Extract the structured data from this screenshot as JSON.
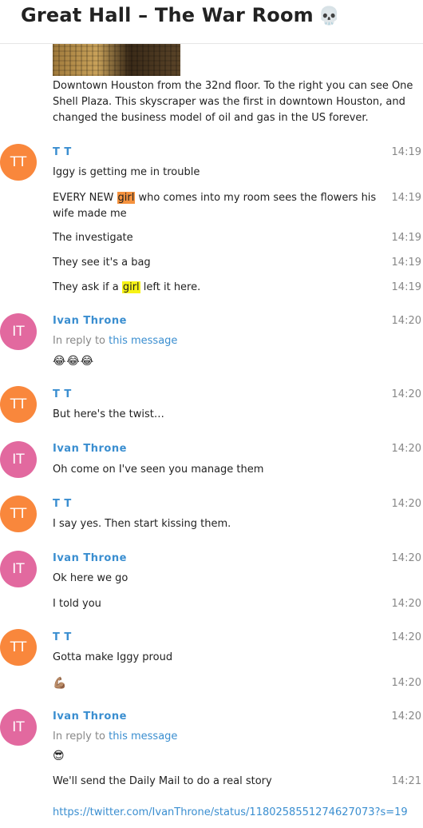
{
  "header": {
    "title": "Great Hall – The War Room",
    "title_emoji": "💀"
  },
  "photo_caption": "Downtown Houston from the 32nd floor. To the right you can see One Shell Plaza. This skyscraper was the first in downtown Houston, and changed the business model of oil and gas in the US forever.",
  "reply_prefix": "In reply to ",
  "reply_link": "this message",
  "groups": [
    {
      "initials": "TT",
      "sender": "T T",
      "messages": [
        {
          "text": "Iggy is getting me in trouble",
          "time": "14:19"
        },
        {
          "pre": "EVERY NEW ",
          "hl": "girl",
          "post": " who comes into my room sees the flowers his",
          "line2": "wife made me",
          "time": "14:19"
        },
        {
          "text": "The investigate",
          "time": "14:19"
        },
        {
          "text": "They see it's a bag",
          "time": "14:19"
        },
        {
          "pre": "They ask if a ",
          "hl": "girl",
          "post": " left it here.",
          "time": "14:19"
        }
      ]
    },
    {
      "initials": "IT",
      "sender": "Ivan Throne",
      "time": "14:20",
      "emoji": "😂😂😂"
    },
    {
      "initials": "TT",
      "sender": "T T",
      "messages": [
        {
          "text": "But here's the twist…",
          "time": "14:20"
        }
      ]
    },
    {
      "initials": "IT",
      "sender": "Ivan Throne",
      "messages": [
        {
          "text": "Oh come on I've seen you manage them",
          "time": "14:20"
        }
      ]
    },
    {
      "initials": "TT",
      "sender": "T T",
      "messages": [
        {
          "text": "I say yes. Then start kissing them.",
          "time": "14:20"
        }
      ]
    },
    {
      "initials": "IT",
      "sender": "Ivan Throne",
      "messages": [
        {
          "text": "Ok here we go",
          "time": "14:20"
        },
        {
          "text": "I told you",
          "time": "14:20"
        }
      ]
    },
    {
      "initials": "TT",
      "sender": "T T",
      "messages": [
        {
          "text": "Gotta make Iggy proud",
          "time": "14:20"
        },
        {
          "text": "💪🏽",
          "time": "14:20"
        }
      ]
    },
    {
      "initials": "IT",
      "sender": "Ivan Throne",
      "time": "14:20",
      "emoji": "😎",
      "messages": [
        {
          "text": "We'll send the Daily Mail to do a real story",
          "time": "14:21"
        }
      ]
    }
  ],
  "footer_link": "https://twitter.com/IvanThrone/status/1180258551274627073?s=19",
  "colors": {
    "tt_avatar": "#f9873c",
    "it_avatar": "#e2699f",
    "sender_name": "#3a8ed0",
    "highlight_orange": "#f5923e",
    "highlight_yellow": "#f7f316"
  }
}
